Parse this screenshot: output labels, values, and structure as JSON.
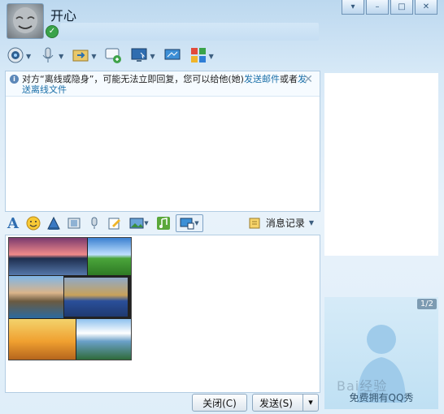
{
  "header": {
    "nickname": "开心",
    "window_buttons": [
      "▾",
      "–",
      "□",
      "✕"
    ]
  },
  "toolbar": {
    "items": [
      {
        "icon": "webcam-icon"
      },
      {
        "icon": "microphone-icon"
      },
      {
        "icon": "file-transfer-icon"
      },
      {
        "icon": "sms-icon"
      },
      {
        "icon": "remote-desktop-icon"
      },
      {
        "icon": "screen-share-icon"
      },
      {
        "icon": "apps-grid-icon"
      }
    ]
  },
  "notice": {
    "text_before": "对方“离线或隐身”，可能无法立即回复，您可以给他(她)",
    "link1": "发送邮件",
    "text_mid": "或者",
    "link2": "发送离线文件",
    "close": "✕"
  },
  "format_toolbar": {
    "font_label": "A",
    "message_record_label": "消息记录"
  },
  "buttons": {
    "close_label": "关闭(C)",
    "send_label": "发送(S)",
    "send_arrow": "▾"
  },
  "right_panel": {
    "page_indicator": "1/2",
    "free_show_text": "免费拥有QQ秀",
    "watermark": "Bai经验"
  }
}
